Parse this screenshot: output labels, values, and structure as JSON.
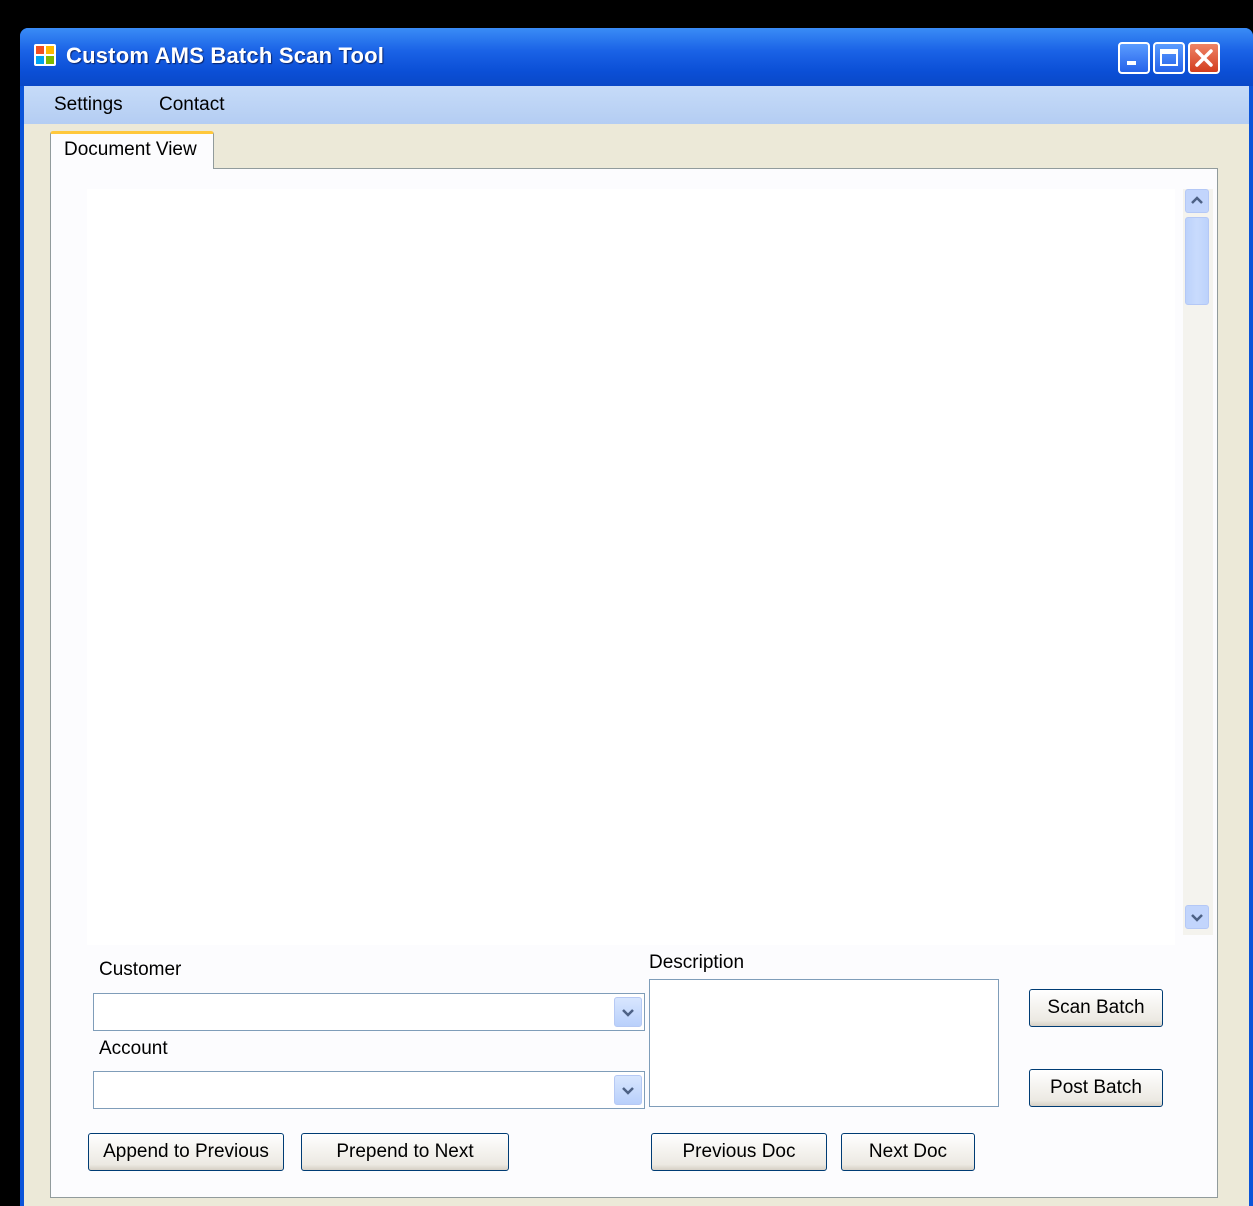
{
  "window": {
    "title": "Custom AMS Batch Scan Tool"
  },
  "menu": {
    "items": [
      "Settings",
      "Contact"
    ]
  },
  "tabs": [
    {
      "label": "Document View",
      "active": true
    }
  ],
  "form": {
    "customer_label": "Customer",
    "customer_value": "",
    "account_label": "Account",
    "account_value": "",
    "description_label": "Description",
    "description_value": ""
  },
  "buttons": {
    "scan_batch": "Scan Batch",
    "post_batch": "Post Batch",
    "append_to_previous": "Append to Previous",
    "prepend_to_next": "Prepend to Next",
    "previous_doc": "Previous Doc",
    "next_doc": "Next Doc"
  },
  "colors": {
    "titlebar": "#0b54d9",
    "menubar": "#c6dbf8",
    "tab_highlight": "#ffc83c",
    "window_bg": "#ece9d8"
  }
}
